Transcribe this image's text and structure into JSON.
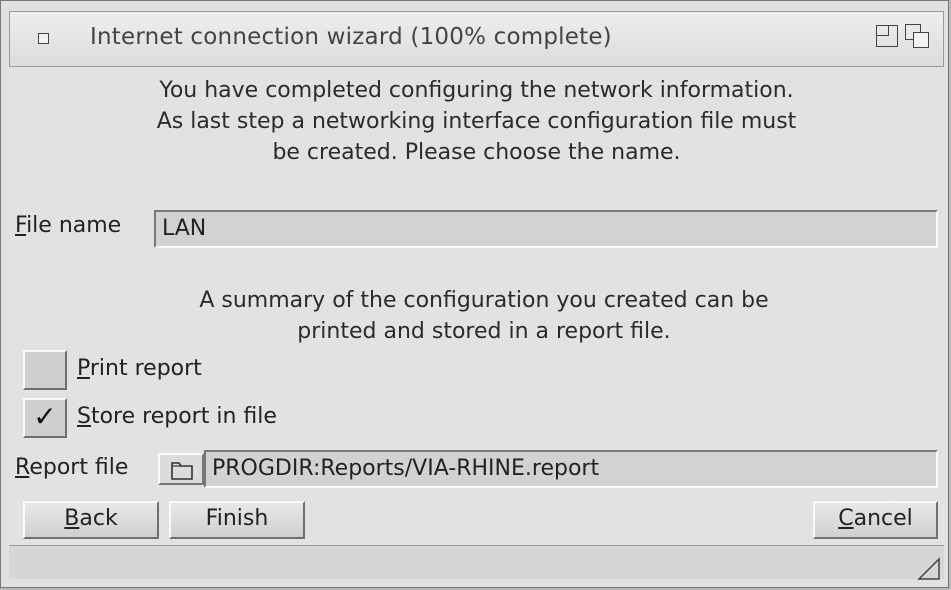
{
  "window": {
    "title": "Internet connection wizard (100% complete)"
  },
  "intro": {
    "line1": "You have completed configuring the network information.",
    "line2": "As last step a networking interface configuration file must",
    "line3": "be created. Please choose the name."
  },
  "file_name": {
    "label_hotkey": "F",
    "label_rest": "ile name",
    "value": "LAN"
  },
  "summary": {
    "line1": "A summary of the configuration you created can be",
    "line2": "printed and stored in a report file."
  },
  "print_report": {
    "label_hotkey": "P",
    "label_rest": "rint report",
    "checked": false
  },
  "store_report": {
    "label_hotkey": "S",
    "label_rest": "tore report in file",
    "checked": true,
    "mark": "✓"
  },
  "report_file": {
    "label_hotkey": "R",
    "label_rest": "eport file",
    "value": "PROGDIR:Reports/VIA-RHINE.report"
  },
  "buttons": {
    "back_hotkey": "B",
    "back_rest": "ack",
    "finish": "Finish",
    "cancel_hotkey": "C",
    "cancel_rest": "ancel"
  },
  "icons": {
    "close": "close-icon",
    "zoom": "zoom-icon",
    "depth": "depth-icon",
    "popfile": "folder-icon",
    "resize": "resize-icon"
  }
}
